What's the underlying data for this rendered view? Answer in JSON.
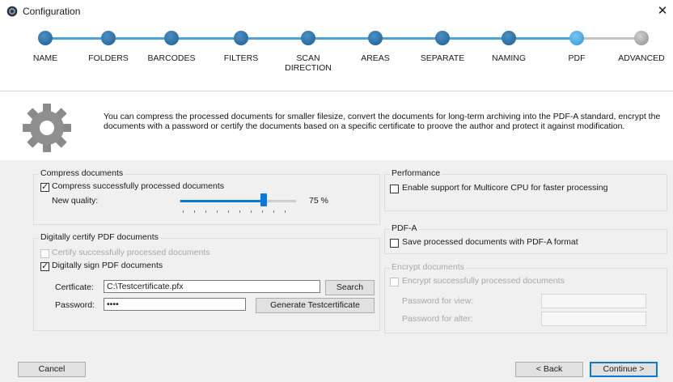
{
  "window": {
    "title": "Configuration",
    "close_glyph": "✕",
    "icon": "app-gear-icon"
  },
  "steps": [
    {
      "label": "NAME",
      "state": "done"
    },
    {
      "label": "FOLDERS",
      "state": "done"
    },
    {
      "label": "BARCODES",
      "state": "done"
    },
    {
      "label": "FILTERS",
      "state": "done"
    },
    {
      "label": "SCAN DIRECTION",
      "label_line1": "SCAN",
      "label_line2": "DIRECTION",
      "state": "done"
    },
    {
      "label": "AREAS",
      "state": "done"
    },
    {
      "label": "SEPARATE",
      "state": "done"
    },
    {
      "label": "NAMING",
      "state": "done"
    },
    {
      "label": "PDF",
      "state": "current"
    },
    {
      "label": "ADVANCED",
      "state": "pending"
    }
  ],
  "description": "You can compress the processed documents for smaller filesize, convert the documents for long-term archiving into the PDF-A standard, encrypt the documents with a password or certify the documents based on a specific certificate to proove the author and protect it against modification.",
  "compress": {
    "title": "Compress documents",
    "checkbox_label": "Compress successfully processed documents",
    "checked": true,
    "quality_label": "New quality:",
    "quality_value": 75,
    "quality_text": "75 %"
  },
  "certify": {
    "title": "Digitally certify PDF documents",
    "certify_label": "Certify successfully processed documents",
    "certify_checked": false,
    "certify_enabled": false,
    "sign_label": "Digitally sign PDF documents",
    "sign_checked": true,
    "certificate_label": "Certficate:",
    "certificate_value": "C:\\Testcertificate.pfx",
    "search_label": "Search",
    "password_label": "Password:",
    "password_value": "••••",
    "generate_label": "Generate Testcertificate"
  },
  "performance": {
    "title": "Performance",
    "checkbox_label": "Enable support for Multicore CPU for faster processing",
    "checked": false
  },
  "pdfa": {
    "title": "PDF-A",
    "checkbox_label": "Save processed documents with PDF-A format",
    "checked": false
  },
  "encrypt": {
    "title": "Encrypt documents",
    "checkbox_label": "Encrypt successfully processed documents",
    "checked": false,
    "enabled": false,
    "view_label": "Password for view:",
    "alter_label": "Password for alter:"
  },
  "footer": {
    "cancel_label": "Cancel",
    "back_label": "< Back",
    "continue_label": "Continue >"
  },
  "colors": {
    "accent": "#0a78d7",
    "step_done": "#1e6fa8",
    "step_line": "#4aa3d9",
    "step_pending": "#a5a5a5",
    "panel_bg": "#f0f0f0"
  }
}
